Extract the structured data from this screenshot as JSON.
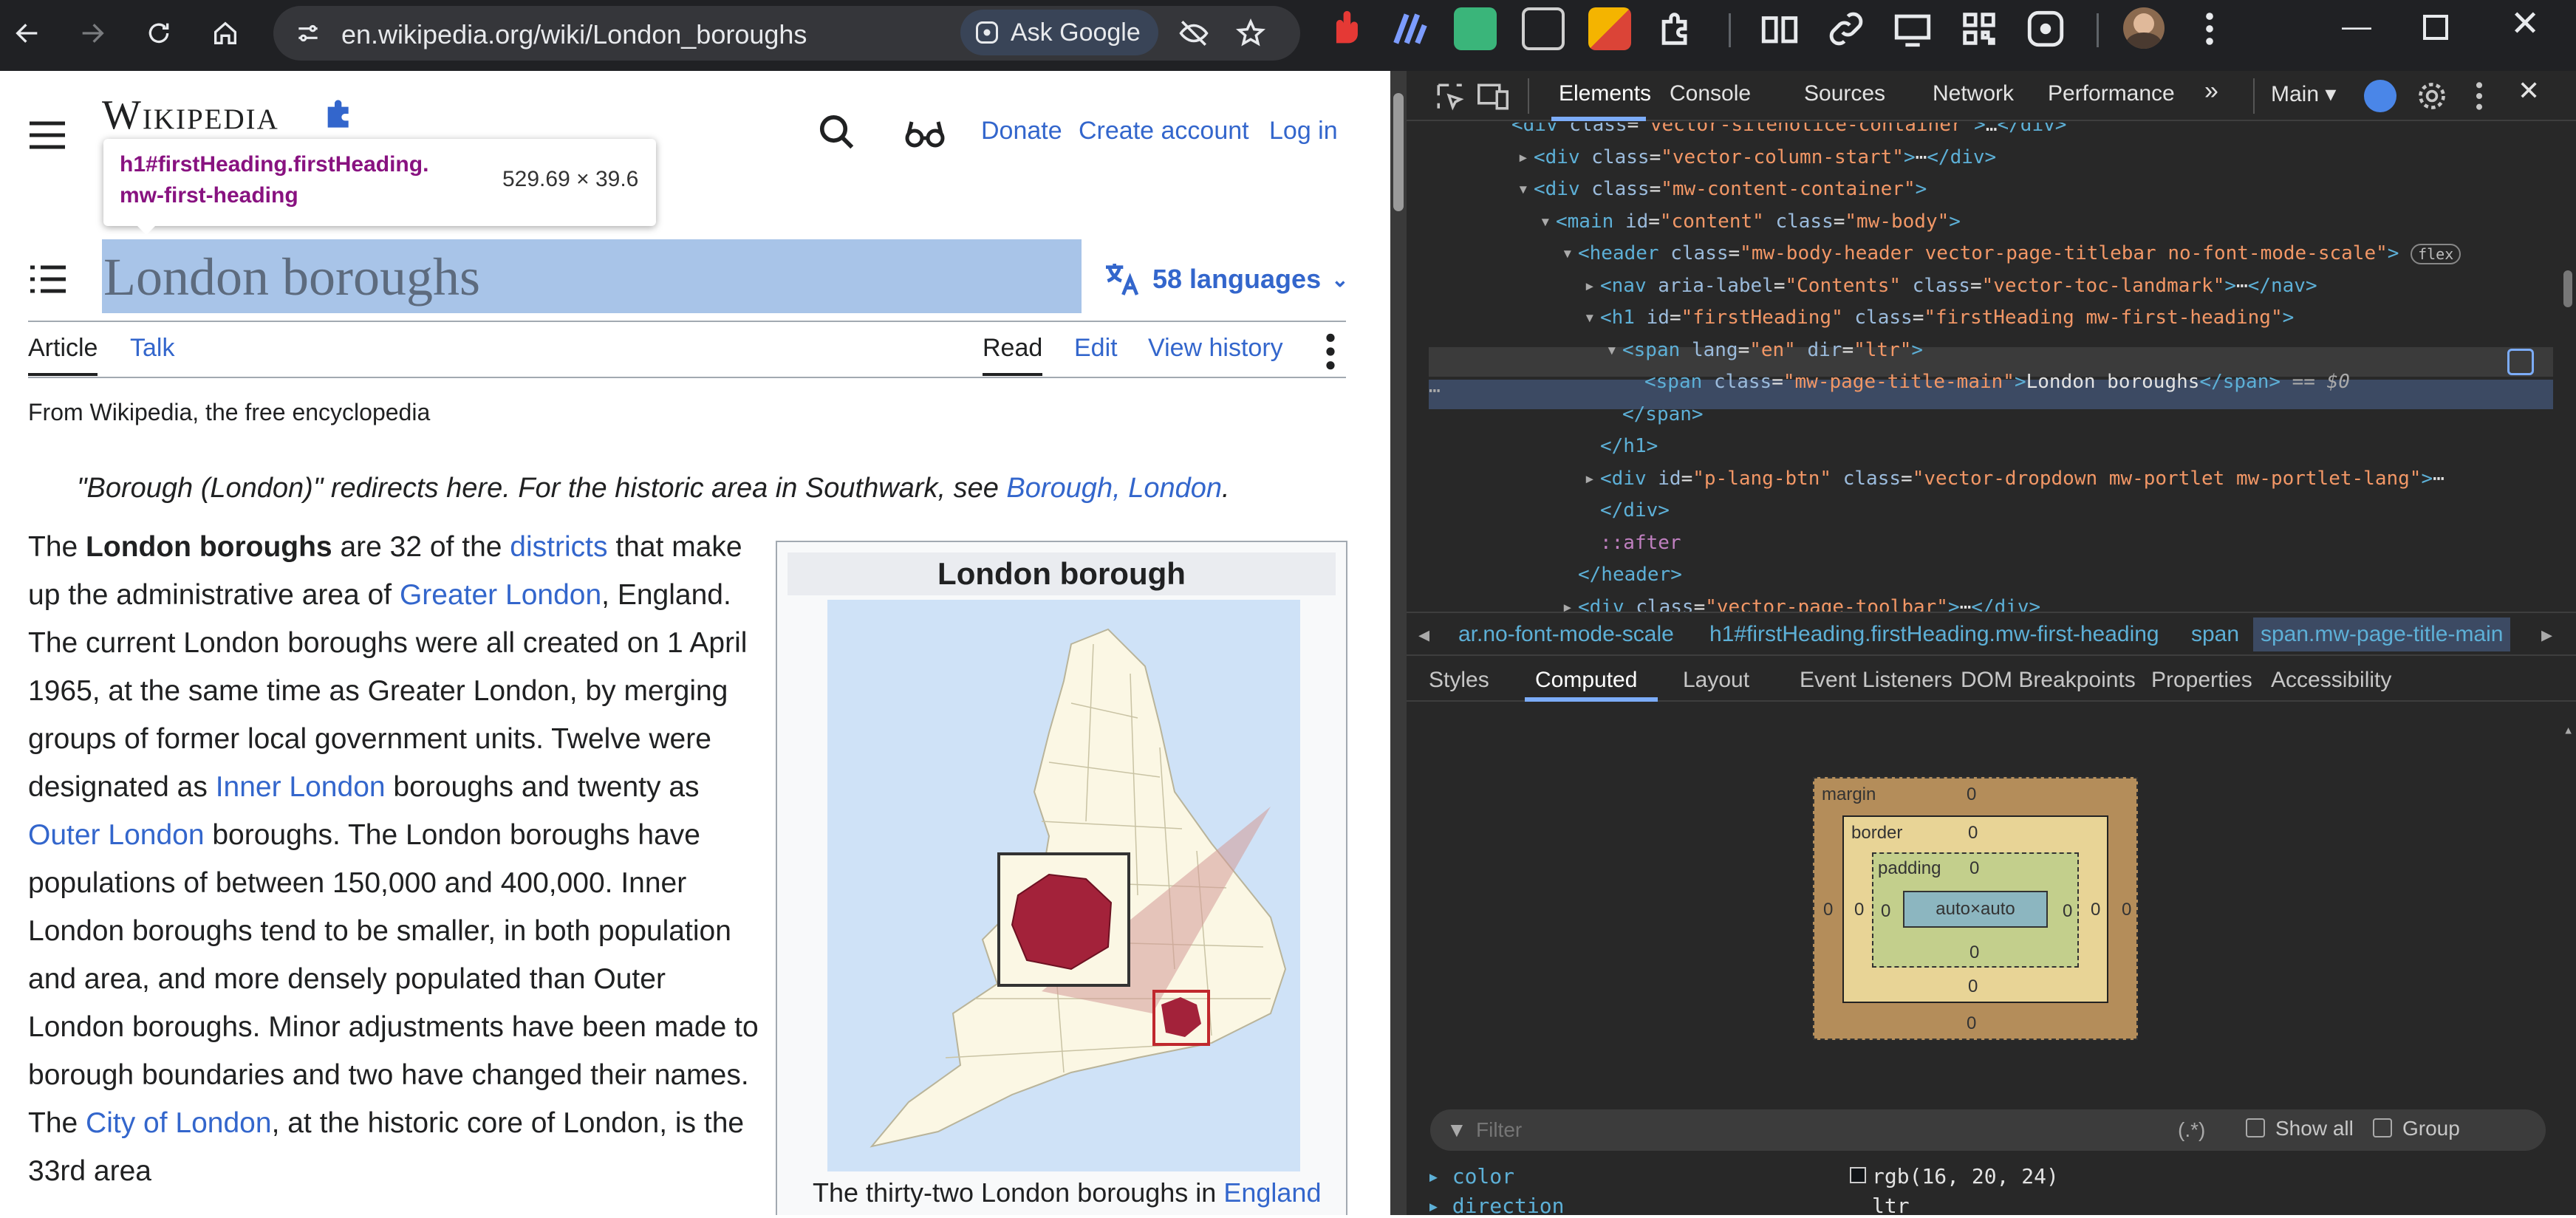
{
  "browser": {
    "url": "en.wikipedia.org/wiki/London_boroughs",
    "ask_google": "Ask Google"
  },
  "wiki": {
    "logo_text": "Wikipedia",
    "header_links": {
      "donate": "Donate",
      "create_account": "Create account",
      "log_in": "Log in"
    },
    "tooltip": {
      "selector": "h1#firstHeading.firstHeading.mw-first-heading",
      "size": "529.69 × 39.6"
    },
    "title": "London boroughs",
    "languages": "58 languages",
    "tabs": {
      "article": "Article",
      "talk": "Talk",
      "read": "Read",
      "edit": "Edit",
      "view_history": "View history"
    },
    "tagline": "From Wikipedia, the free encyclopedia",
    "hatnote": {
      "text": "\"Borough (London)\" redirects here. For the historic area in Southwark, see ",
      "link": "Borough, London",
      "end": "."
    },
    "infobox": {
      "title": "London borough",
      "caption_text": "The thirty-two London boroughs in ",
      "caption_link": "England"
    },
    "body": {
      "p1": "The ",
      "p2": "London boroughs",
      "p3": " are 32 of the ",
      "l_districts": "districts",
      "p4": " that make up the administrative area of ",
      "l_greater_london": "Greater London",
      "p5": ", England. The current London boroughs were all created on 1 April 1965, at the same time as Greater London, by merging groups of former local government units. Twelve were designated as ",
      "l_inner": "Inner London",
      "p6": " boroughs and twenty as ",
      "l_outer": "Outer London",
      "p7": " boroughs. The London boroughs have populations of between 150,000 and 400,000. Inner London boroughs tend to be smaller, in both population and area, and more densely populated than Outer London boroughs. Minor adjustments have been made to borough boundaries and two have changed their names. The ",
      "l_city": "City of London",
      "p8": ", at the historic core of London, is the 33rd area"
    }
  },
  "devtools": {
    "tabs": [
      "Elements",
      "Console",
      "Sources",
      "Network",
      "Performance"
    ],
    "context": "Main",
    "dom_lines": [
      {
        "indent": 0,
        "arrow": "",
        "html": "<span class='tag'>&lt;div</span> <span class='attr'>class</span>=<span class='val'>\"vector-sitenotice-container\"</span><span class='tag'>&gt;</span>…<span class='tag'>&lt;/div&gt;</span>"
      },
      {
        "indent": 1,
        "arrow": "▸",
        "html": "<span class='tag'>&lt;div</span> <span class='attr'>class</span>=<span class='val'>\"vector-column-start\"</span><span class='tag'>&gt;</span>⋯<span class='tag'>&lt;/div&gt;</span>"
      },
      {
        "indent": 1,
        "arrow": "▾",
        "html": "<span class='tag'>&lt;div</span> <span class='attr'>class</span>=<span class='val'>\"mw-content-container\"</span><span class='tag'>&gt;</span>"
      },
      {
        "indent": 2,
        "arrow": "▾",
        "html": "<span class='tag'>&lt;main</span> <span class='attr'>id</span>=<span class='val'>\"content\"</span> <span class='attr'>class</span>=<span class='val'>\"mw-body\"</span><span class='tag'>&gt;</span>"
      },
      {
        "indent": 3,
        "arrow": "▾",
        "html": "<span class='tag'>&lt;header</span> <span class='attr'>class</span>=<span class='val'>\"mw-body-header vector-page-titlebar no-font-mode-scale\"</span><span class='tag'>&gt;</span> <span class='pill'>flex</span>"
      },
      {
        "indent": 4,
        "arrow": "▸",
        "html": "<span class='tag'>&lt;nav</span> <span class='attr'>aria-label</span>=<span class='val'>\"Contents\"</span> <span class='attr'>class</span>=<span class='val'>\"vector-toc-landmark\"</span><span class='tag'>&gt;</span>⋯<span class='tag'>&lt;/nav&gt;</span>"
      },
      {
        "indent": 4,
        "arrow": "▾",
        "html": "<span class='tag'>&lt;h1</span> <span class='attr'>id</span>=<span class='val'>\"firstHeading\"</span> <span class='attr'>class</span>=<span class='val'>\"firstHeading mw-first-heading\"</span><span class='tag'>&gt;</span>"
      },
      {
        "indent": 5,
        "arrow": "▾",
        "html": "<span class='tag'>&lt;span</span> <span class='attr'>lang</span>=<span class='val'>\"en\"</span> <span class='attr'>dir</span>=<span class='val'>\"ltr\"</span><span class='tag'>&gt;</span>"
      },
      {
        "indent": 6,
        "arrow": "",
        "html": "<span class='tag'>&lt;span</span> <span class='attr'>class</span>=<span class='val'>\"mw-page-title-main\"</span><span class='tag'>&gt;</span>London boroughs<span class='tag'>&lt;/span&gt;</span> <i style='color:#aaa'>== $0</i>"
      },
      {
        "indent": 5,
        "arrow": "",
        "html": "<span class='tag'>&lt;/span&gt;</span>"
      },
      {
        "indent": 4,
        "arrow": "",
        "html": "<span class='tag'>&lt;/h1&gt;</span>"
      },
      {
        "indent": 4,
        "arrow": "▸",
        "html": "<span class='tag'>&lt;div</span> <span class='attr'>id</span>=<span class='val'>\"p-lang-btn\"</span> <span class='attr'>class</span>=<span class='val'>\"vector-dropdown mw-portlet mw-portlet-lang\"</span><span class='tag'>&gt;</span>⋯"
      },
      {
        "indent": 4,
        "arrow": "",
        "html": "<span class='tag'>&lt;/div&gt;</span>"
      },
      {
        "indent": 4,
        "arrow": "",
        "html": "<span style='color:#c080c0'>::after</span>"
      },
      {
        "indent": 3,
        "arrow": "",
        "html": "<span class='tag'>&lt;/header&gt;</span>"
      },
      {
        "indent": 3,
        "arrow": "▸",
        "html": "<span class='tag'>&lt;div</span> <span class='attr'>class</span>=<span class='val'>\"vector-page-toolbar\"</span><span class='tag'>&gt;</span>⋯<span class='tag'>&lt;/div&gt;</span>"
      }
    ],
    "breadcrumbs": [
      "ar.no-font-mode-scale",
      "h1#firstHeading.firstHeading.mw-first-heading",
      "span",
      "span.mw-page-title-main"
    ],
    "subtabs": [
      "Styles",
      "Computed",
      "Layout",
      "Event Listeners",
      "DOM Breakpoints",
      "Properties",
      "Accessibility"
    ],
    "boxmodel": {
      "margin": "margin",
      "border": "border",
      "padding": "padding",
      "content": "auto×auto",
      "zero": "0"
    },
    "filter": {
      "placeholder": "Filter",
      "regex": "(.*)",
      "show_all": "Show all",
      "group": "Group"
    },
    "props": [
      {
        "name": "color",
        "value": "rgb(16, 20, 24)"
      },
      {
        "name": "direction",
        "value": "ltr"
      }
    ]
  }
}
